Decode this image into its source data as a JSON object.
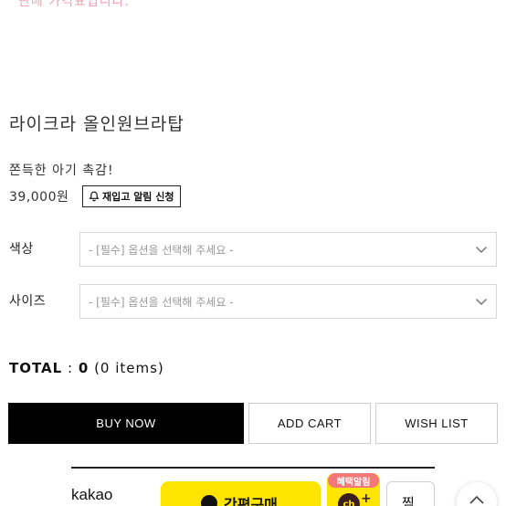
{
  "top_note": "판매 가격표입니다.",
  "product": {
    "title": "라이크라 올인원브라탑",
    "description": "쫀득한 아기 촉감!",
    "price": "39,000원",
    "restock_label": "재입고 알림 신청"
  },
  "options": [
    {
      "label": "색상",
      "placeholder": "- [필수] 옵션을 선택해 주세요 -"
    },
    {
      "label": "사이즈",
      "placeholder": "- [필수] 옵션을 선택해 주세요 -"
    }
  ],
  "total": {
    "prefix": "TOTAL",
    "separator": ":",
    "amount": "0",
    "items": "(0 items)"
  },
  "buttons": {
    "buy": "BUY NOW",
    "cart": "ADD CART",
    "wish": "WISH LIST"
  },
  "kakao": {
    "logo": "kakao",
    "pay_label": "간편구매",
    "channel_badge": "혜택알림",
    "channel_logo": "ch",
    "zzim": "찜"
  },
  "icons": {
    "bell": "bell-icon",
    "chevron": "chevron-down-icon",
    "scroll_top": "chevron-up-icon"
  },
  "colors": {
    "accent_black": "#000000",
    "kakao_yellow": "#fee500",
    "badge_pink": "#f37979"
  }
}
